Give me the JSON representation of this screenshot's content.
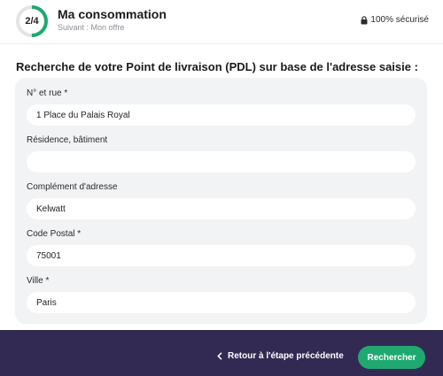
{
  "header": {
    "progress_label": "2/4",
    "progress_fraction": 0.5,
    "title": "Ma consommation",
    "subtitle": "Suivant : Mon offre",
    "secure_label": "100% sécurisé",
    "accent_color": "#1fa971"
  },
  "form": {
    "title": "Recherche de votre Point de livraison (PDL) sur base de l'adresse saisie :",
    "fields": [
      {
        "label": "N° et rue *",
        "value": "1 Place du Palais Royal",
        "placeholder": ""
      },
      {
        "label": "Résidence, bâtiment",
        "value": "",
        "placeholder": ""
      },
      {
        "label": "Complément d'adresse",
        "value": "Kelwatt",
        "placeholder": ""
      },
      {
        "label": "Code Postal *",
        "value": "75001",
        "placeholder": ""
      },
      {
        "label": "Ville *",
        "value": "Paris",
        "placeholder": ""
      }
    ]
  },
  "footer": {
    "back_label": "Retour à l'étape précédente",
    "search_label": "Rechercher",
    "background_color": "#332a54",
    "button_color": "#1fa971"
  },
  "icons": {
    "lock": "lock-icon",
    "back": "chevron-left-icon"
  }
}
